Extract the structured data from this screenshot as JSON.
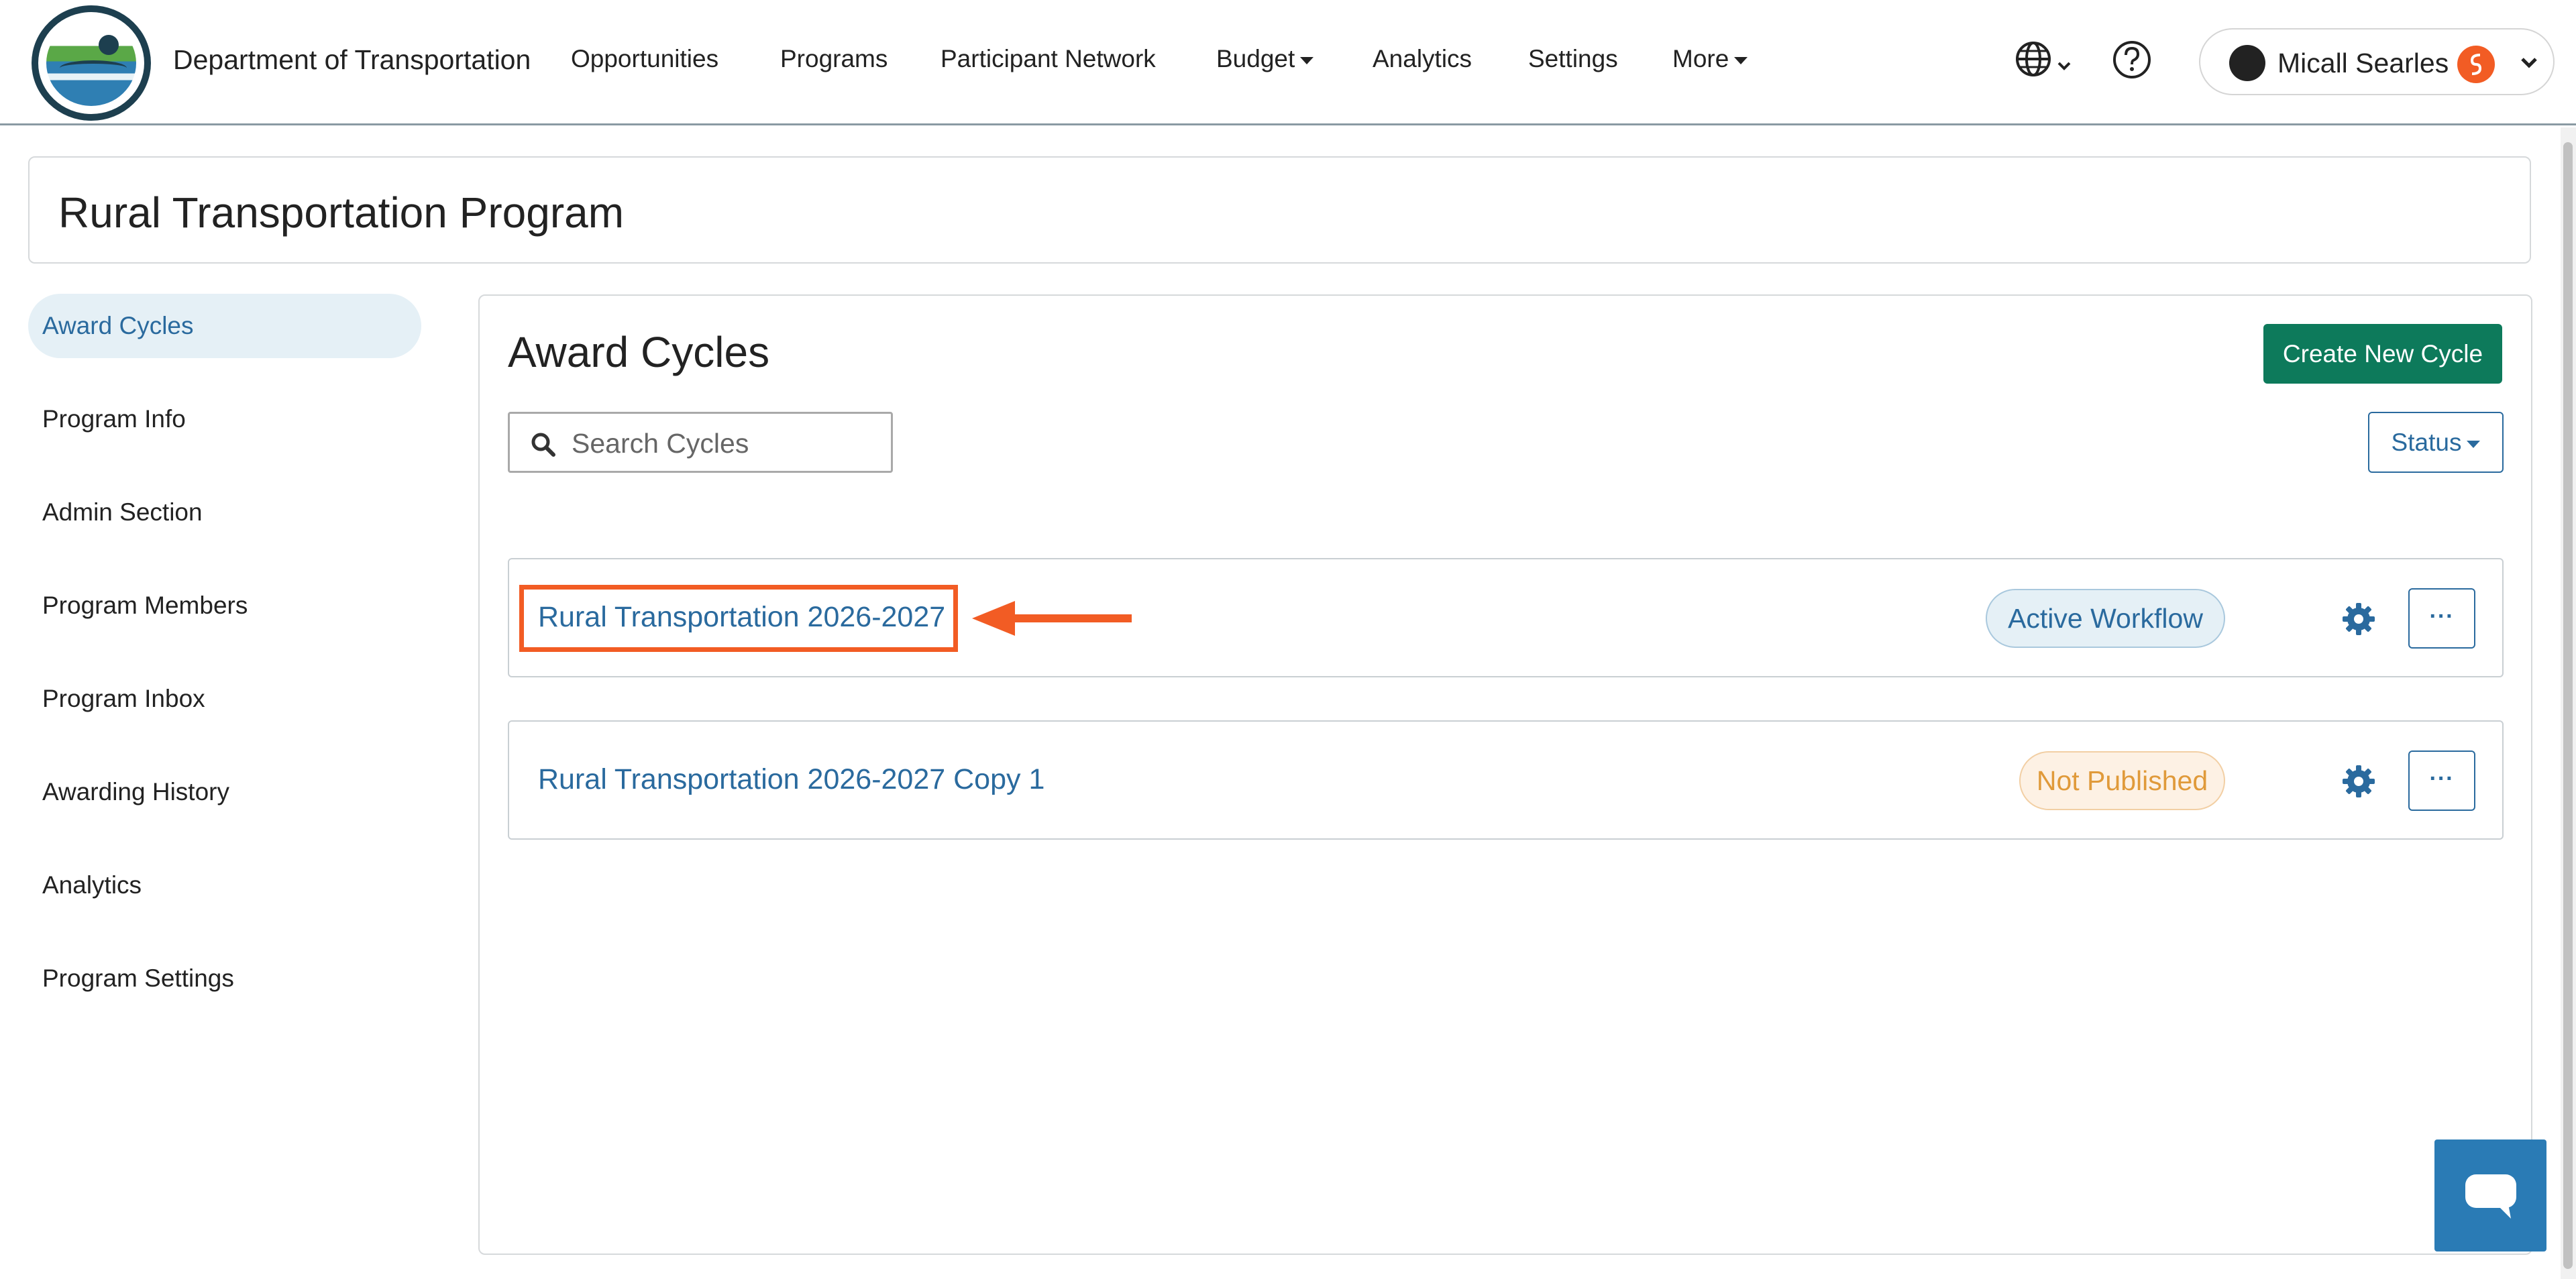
{
  "app": {
    "org_name": "Department of Transportation",
    "logo_icon": "agency-seal-logo"
  },
  "nav": {
    "links": [
      "Opportunities",
      "Programs",
      "Participant Network",
      "Budget",
      "Analytics",
      "Settings",
      "More"
    ],
    "language_icon": "globe-icon",
    "help_icon": "help-circle-icon"
  },
  "user": {
    "name": "Micall Searles",
    "badge_icon": "brand-s-icon"
  },
  "program": {
    "title": "Rural Transportation Program"
  },
  "sidebar": {
    "items": [
      {
        "label": "Award Cycles",
        "active": true
      },
      {
        "label": "Program Info",
        "active": false
      },
      {
        "label": "Admin Section",
        "active": false
      },
      {
        "label": "Program Members",
        "active": false
      },
      {
        "label": "Program Inbox",
        "active": false
      },
      {
        "label": "Awarding History",
        "active": false
      },
      {
        "label": "Analytics",
        "active": false
      },
      {
        "label": "Program Settings",
        "active": false
      }
    ]
  },
  "main": {
    "title": "Award Cycles",
    "create_button": "Create New Cycle",
    "search_placeholder": "Search Cycles",
    "search_value": "",
    "status_filter": "Status",
    "cycles": [
      {
        "name": "Rural Transportation 2026-2027",
        "status": "Active Workflow",
        "highlighted": true
      },
      {
        "name": "Rural Transportation 2026-2027 Copy 1",
        "status": "Not Published",
        "highlighted": false
      }
    ],
    "more_button": "···"
  },
  "colors": {
    "accent": "#2a6a9e",
    "primary_button": "#0d7a5b",
    "annotation": "#f25c24",
    "active_pill_bg": "#e5f0f6",
    "unpublished_pill_text": "#e09a3a"
  },
  "chat_widget_icon": "chat-bubble-icon"
}
